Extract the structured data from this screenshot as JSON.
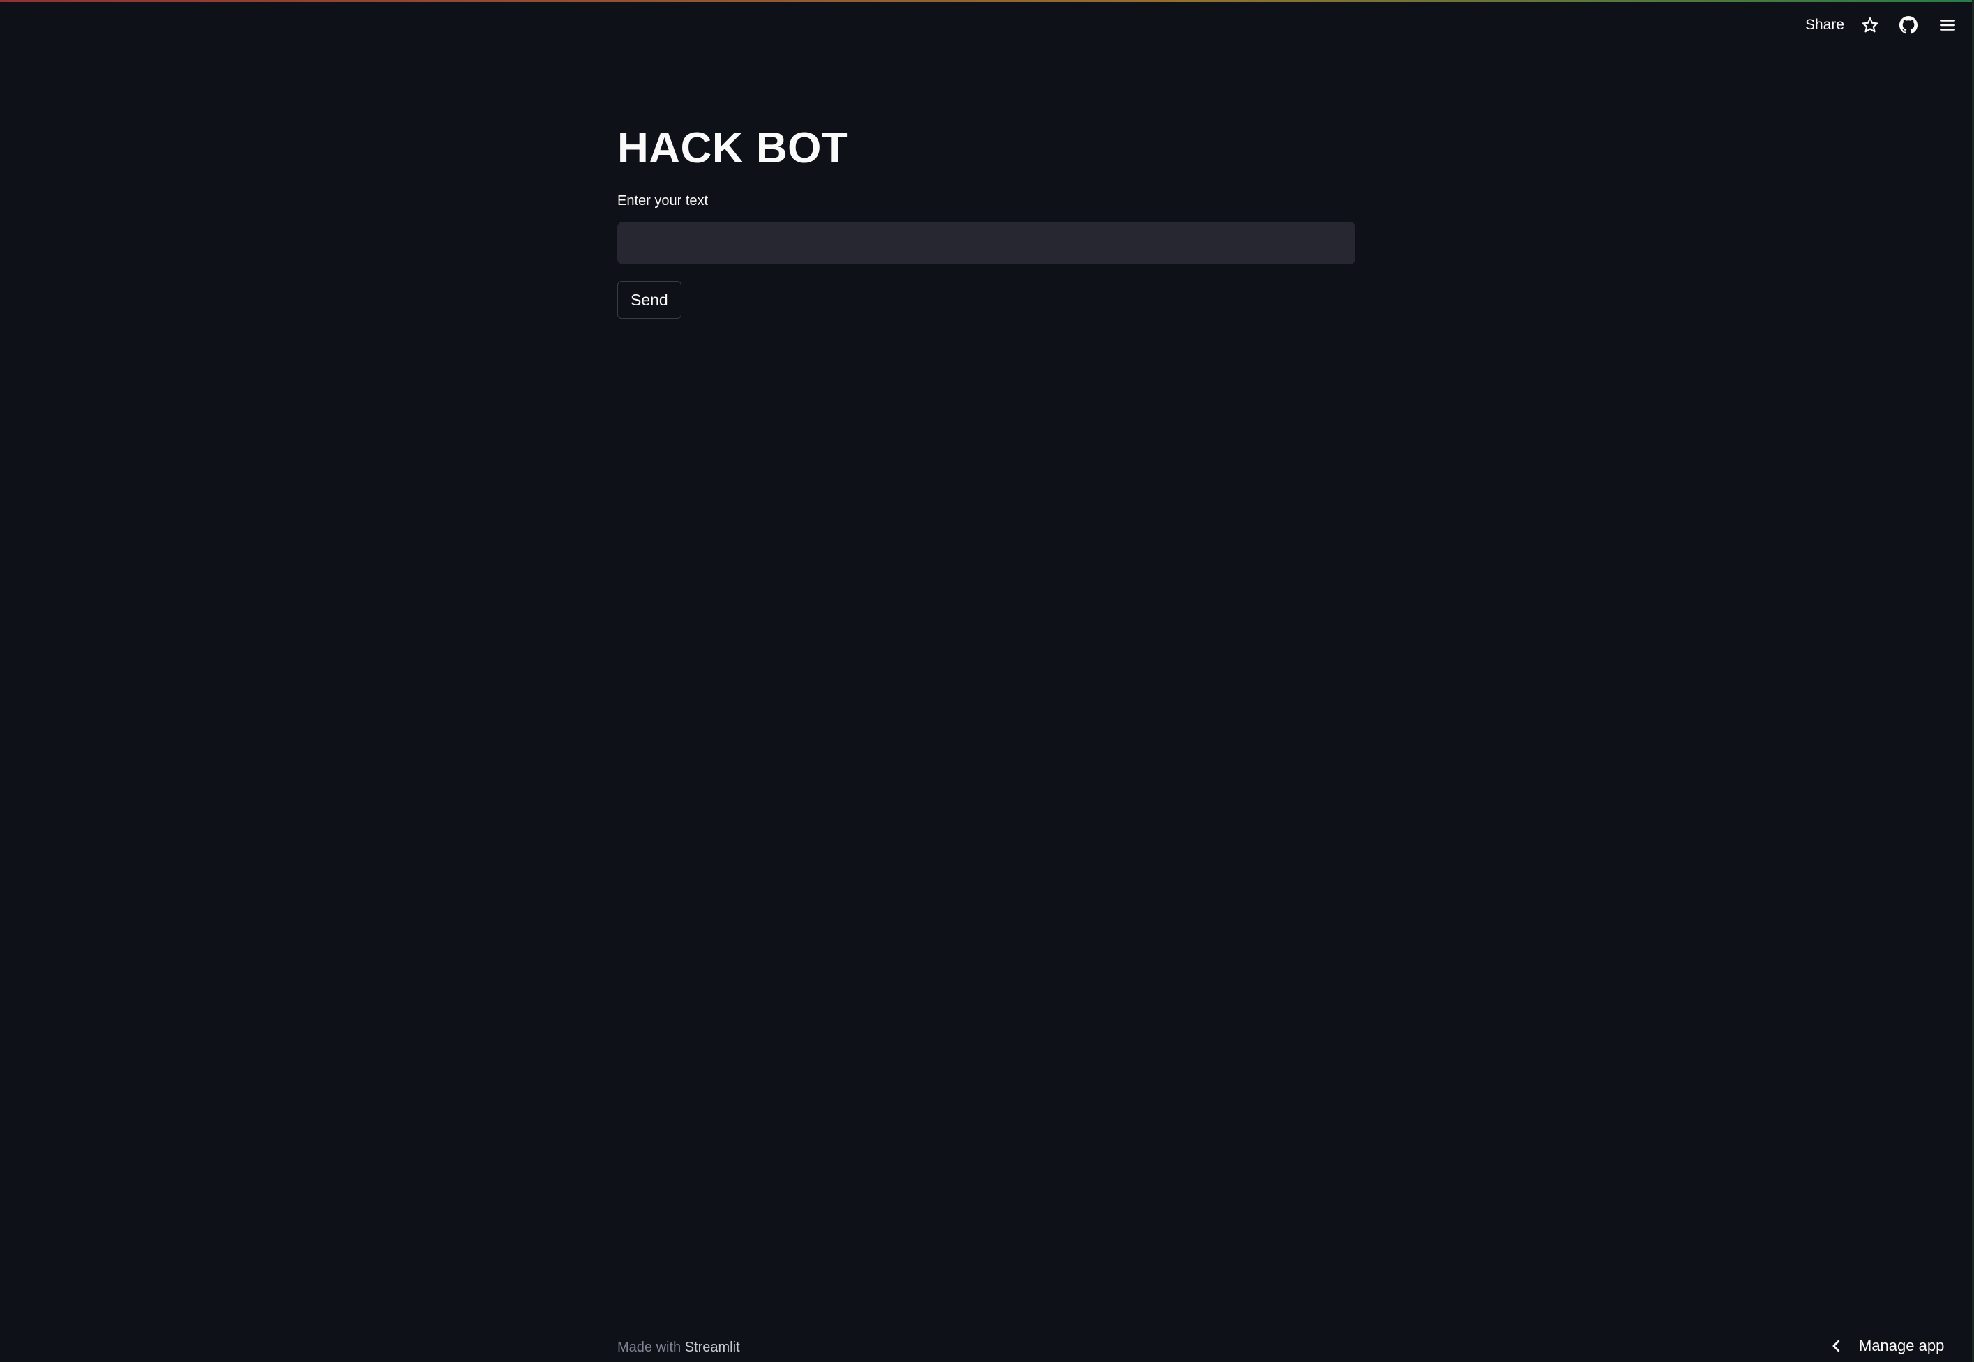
{
  "toolbar": {
    "share_label": "Share",
    "icons": [
      "star-icon",
      "github-icon",
      "hamburger-menu-icon"
    ]
  },
  "main": {
    "title": "HACK BOT",
    "input_label": "Enter your text",
    "input_value": "",
    "send_label": "Send"
  },
  "footer": {
    "made_with": "Made with",
    "brand": "Streamlit",
    "manage_app_label": "Manage app"
  },
  "colors": {
    "background": "#0e1117",
    "input_background": "#262730",
    "text": "#fafafa",
    "muted_text": "#808495"
  }
}
